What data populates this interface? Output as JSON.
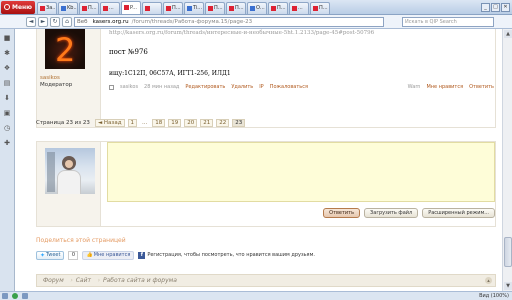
{
  "browser": {
    "menu_label": "Меню",
    "tabs": [
      {
        "label": "За...",
        "fav": "red",
        "active": false
      },
      {
        "label": "Kb...",
        "fav": "blue",
        "active": false
      },
      {
        "label": "П...",
        "fav": "red",
        "active": false
      },
      {
        "label": "...",
        "fav": "red",
        "active": false
      },
      {
        "label": "P...",
        "fav": "red",
        "active": true
      },
      {
        "label": "",
        "fav": "red",
        "active": false
      },
      {
        "label": "П...",
        "fav": "red",
        "active": false
      },
      {
        "label": "Ti...",
        "fav": "blue",
        "active": false
      },
      {
        "label": "П...",
        "fav": "red",
        "active": false
      },
      {
        "label": "П...",
        "fav": "red",
        "active": false
      },
      {
        "label": "О...",
        "fav": "blue",
        "active": false
      },
      {
        "label": "П...",
        "fav": "red",
        "active": false
      },
      {
        "label": "...",
        "fav": "red",
        "active": false
      },
      {
        "label": "П...",
        "fav": "red",
        "active": false
      }
    ],
    "url_label": "Веб",
    "url_host": "kasers.org.ru",
    "url_path": "/forum/threads/Работа-форума.15/page-23",
    "search_placeholder": "Искать в QIP Search",
    "zoom": "Вид (100%)"
  },
  "post": {
    "avatar_digit": "2",
    "username": "sasikos",
    "role": "Модератор",
    "link": "http://kasers.org.ru/forum/threads/интересные-и-необычные-5ht.1.2133/page-45#post-50796",
    "title": "пост №976",
    "body": "ищу:1С12П, 06С57А, ИГТ1-256, ИЛД1",
    "meta": {
      "author": "sasikos",
      "time": "28 мин назад",
      "edit": "Редактировать",
      "delete": "Удалить",
      "ip": "IP",
      "report": "Пожаловаться",
      "warn": "Warn",
      "like": "Мне нравится",
      "reply": "Ответить"
    }
  },
  "pagination": {
    "label": "Страница 23 из 23",
    "prev": "◄ Назад",
    "first": "1",
    "ellipsis": "...",
    "pages": [
      "18",
      "19",
      "20",
      "21",
      "22",
      "23"
    ]
  },
  "reply": {
    "reply_button": "Ответить",
    "upload_button": "Загрузить файл",
    "advanced_button": "Расширенный режим..."
  },
  "share": {
    "title": "Поделиться этой страницей",
    "tweet": "Tweet",
    "tweet_count": "0",
    "fb_like": "Мне нравится",
    "fb_text": "Регистрация, чтобы посмотреть, что нравится вашим друзьям."
  },
  "breadcrumbs": [
    "Форум",
    "Сайт",
    "Работа сайта и форума"
  ]
}
